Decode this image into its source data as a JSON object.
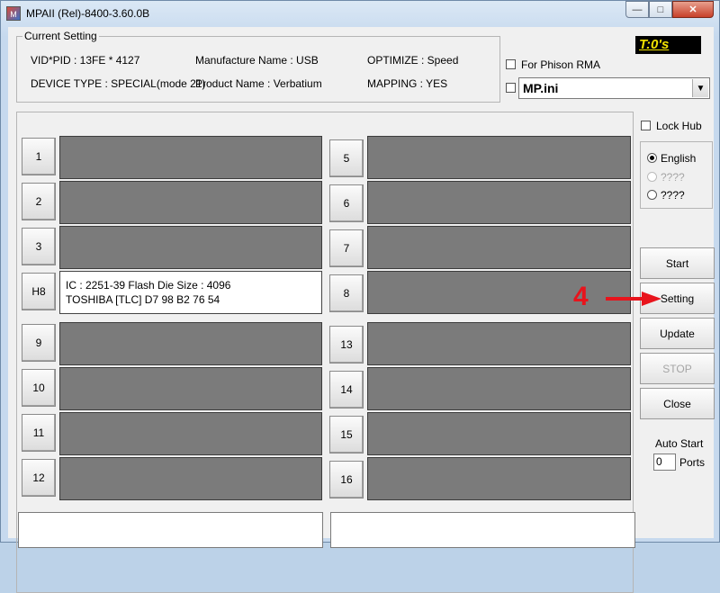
{
  "window": {
    "title": "MPAII (Rel)-8400-3.60.0B",
    "app_icon_text": "M"
  },
  "current_setting": {
    "title": "Current Setting",
    "vid_pid": "VID*PID : 13FE * 4127",
    "manufacture": "Manufacture Name : USB",
    "optimize": "OPTIMIZE : Speed",
    "device_type": "DEVICE TYPE : SPECIAL(mode 21)",
    "product": "Product Name : Verbatium",
    "mapping": "MAPPING : YES"
  },
  "timer": "T:0's",
  "phison_rma": "For Phison RMA",
  "ini_combo": {
    "value": "MP.ini"
  },
  "lock_hub": "Lock Hub",
  "languages": {
    "english": "English",
    "lang2": "????",
    "lang3": "????"
  },
  "buttons": {
    "start": "Start",
    "setting": "Setting",
    "update": "Update",
    "stop": "STOP",
    "close": "Close"
  },
  "auto_start": {
    "label": "Auto Start",
    "value": "0",
    "ports_label": "Ports"
  },
  "ports": {
    "p1": "1",
    "p2": "2",
    "p3": "3",
    "p4": "H8",
    "p5": "5",
    "p6": "6",
    "p7": "7",
    "p8": "8",
    "p9": "9",
    "p10": "10",
    "p11": "11",
    "p12": "12",
    "p13": "13",
    "p14": "14",
    "p15": "15",
    "p16": "16"
  },
  "active_port_info": {
    "line1": "IC : 2251-39  Flash Die Size : 4096",
    "line2": "TOSHIBA [TLC] D7 98 B2 76 54"
  },
  "annotation": {
    "number": "4",
    "color": "#e8141c"
  }
}
